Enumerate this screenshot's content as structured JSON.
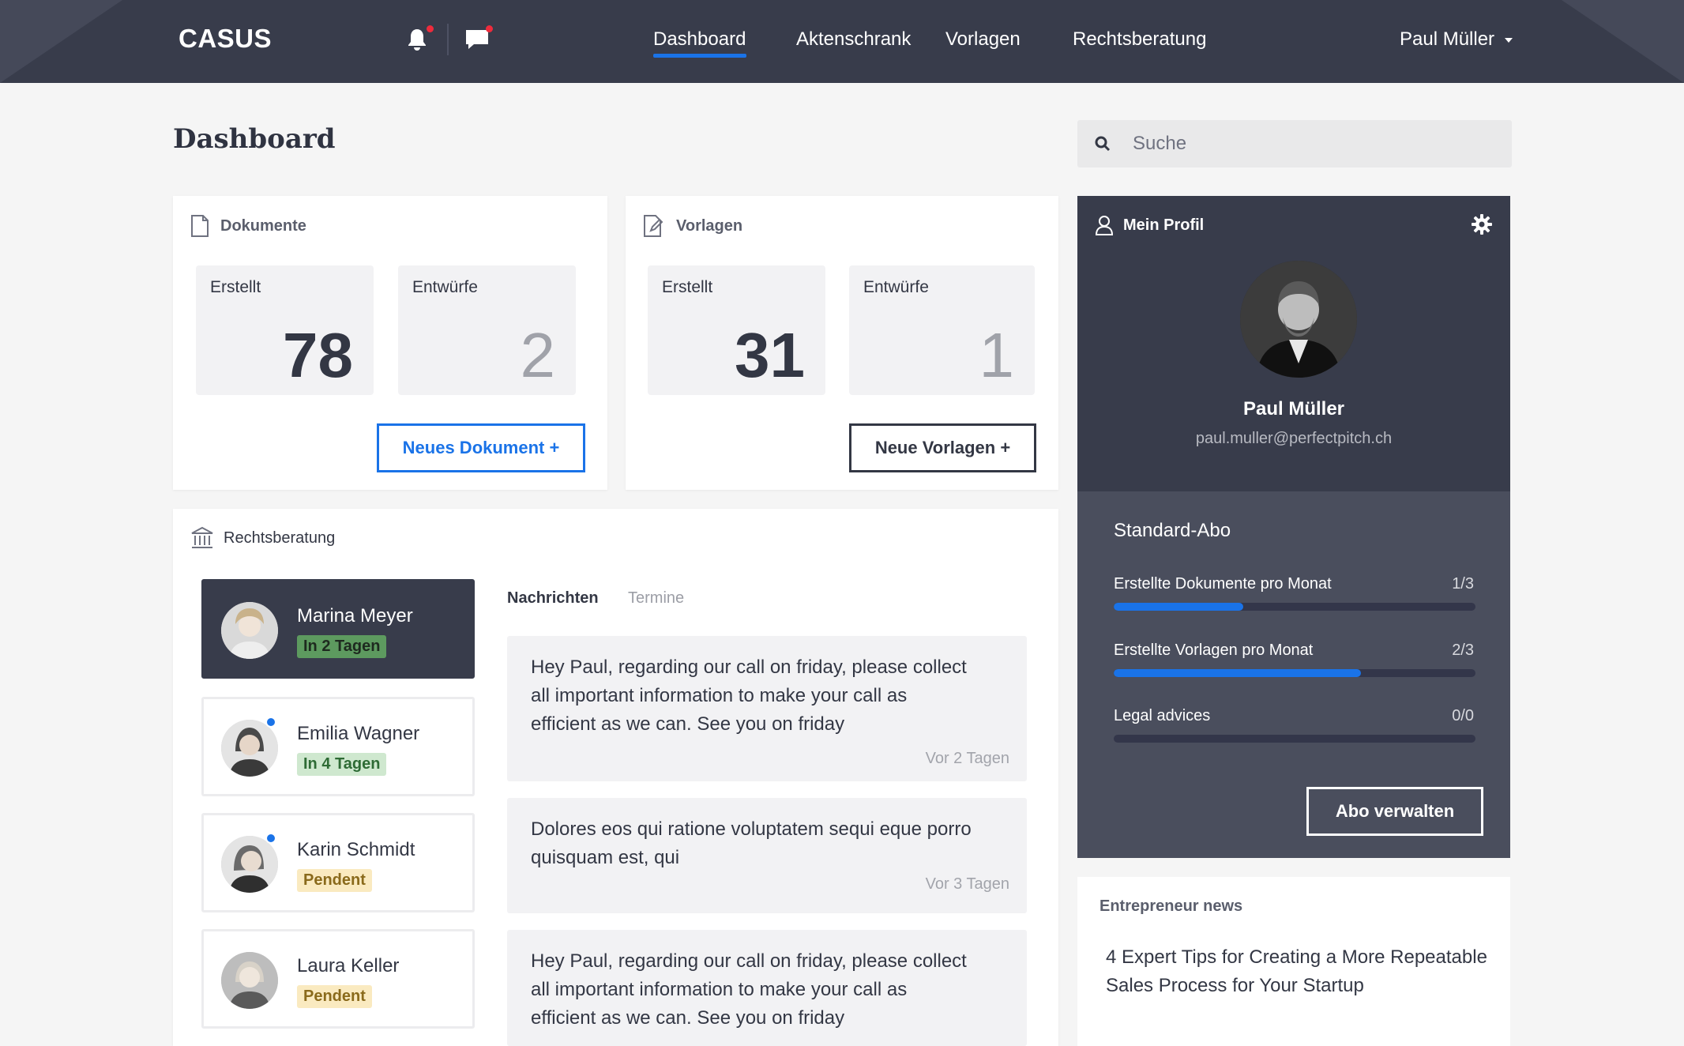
{
  "nav": {
    "logo": "CASUS",
    "items": [
      {
        "label": "Dashboard",
        "active": true
      },
      {
        "label": "Aktenschrank"
      },
      {
        "label": "Vorlagen"
      },
      {
        "label": "Rechtsberatung"
      }
    ],
    "user": "Paul Müller",
    "icons": [
      "bell-icon",
      "chat-icon"
    ]
  },
  "page": {
    "title": "Dashboard",
    "search_placeholder": "Suche"
  },
  "dokumente": {
    "title": "Dokumente",
    "created_label": "Erstellt",
    "created_value": "78",
    "drafts_label": "Entwürfe",
    "drafts_value": "2",
    "button": "Neues Dokument +"
  },
  "vorlagen": {
    "title": "Vorlagen",
    "created_label": "Erstellt",
    "created_value": "31",
    "drafts_label": "Entwürfe",
    "drafts_value": "1",
    "button": "Neue Vorlagen +"
  },
  "rechtsberatung": {
    "title": "Rechtsberatung",
    "lawyers": [
      {
        "name": "Marina Meyer",
        "badge": "In 2 Tagen"
      },
      {
        "name": "Emilia Wagner",
        "badge": "In 4 Tagen"
      },
      {
        "name": "Karin Schmidt",
        "badge": "Pendent"
      },
      {
        "name": "Laura Keller",
        "badge": "Pendent"
      }
    ],
    "tabs": [
      "Nachrichten",
      "Termine"
    ],
    "messages": [
      {
        "text": "Hey Paul, regarding our call on friday, please collect all important information to make your call as efficient as we can. See you on friday",
        "time": "Vor 2 Tagen"
      },
      {
        "text": "Dolores eos qui ratione voluptatem sequi eque porro quisquam est, qui",
        "time": "Vor 3 Tagen"
      },
      {
        "text": "Hey Paul, regarding our call on friday, please collect all important information to make your call as efficient as we can. See you on friday",
        "time": ""
      }
    ]
  },
  "profile": {
    "title": "Mein Profil",
    "name": "Paul Müller",
    "email": "paul.muller@perfectpitch.ch"
  },
  "abo": {
    "title": "Standard-Abo",
    "rows": [
      {
        "label": "Erstellte Dokumente pro Monat",
        "value": "1/3",
        "progress": 0.357
      },
      {
        "label": "Erstellte Vorlagen pro Monat",
        "value": "2/3",
        "progress": 0.683
      },
      {
        "label": "Legal advices",
        "value": "0/0",
        "progress": 0
      }
    ],
    "button": "Abo verwalten"
  },
  "news": {
    "title": "Entrepreneur news",
    "items": [
      "4 Expert Tips for Creating a More Repeatable Sales Process for Your Startup"
    ]
  },
  "colors": {
    "accent": "#1a73e8",
    "navbar": "#383c4b",
    "panel": "#4a4e5d"
  }
}
